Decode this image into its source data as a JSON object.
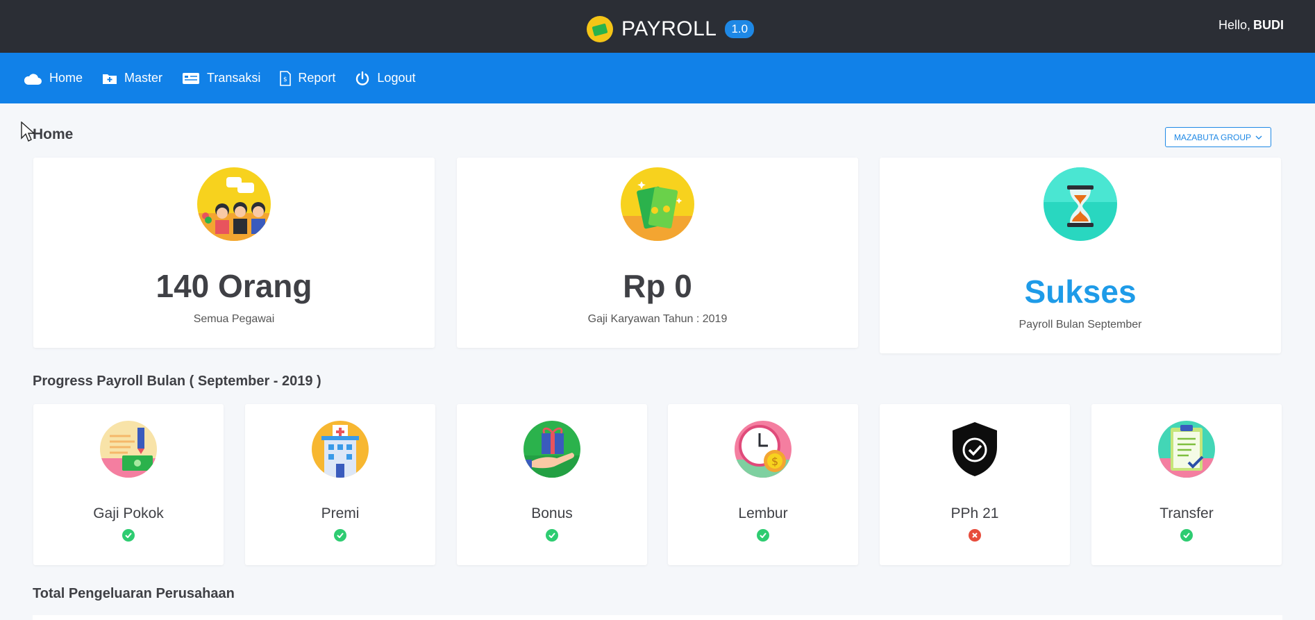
{
  "app": {
    "name": "PAYROLL",
    "version": "1.0",
    "greeting": "Hello,",
    "user": "BUDI"
  },
  "nav": [
    {
      "label": "Home",
      "icon": "cloud-icon"
    },
    {
      "label": "Master",
      "icon": "folder-plus-icon"
    },
    {
      "label": "Transaksi",
      "icon": "card-icon"
    },
    {
      "label": "Report",
      "icon": "invoice-icon"
    },
    {
      "label": "Logout",
      "icon": "power-icon"
    }
  ],
  "page": {
    "title": "Home",
    "company": "MAZABUTA GROUP"
  },
  "stats": [
    {
      "value": "140 Orang",
      "label": "Semua Pegawai",
      "icon": "people-icon"
    },
    {
      "value": "Rp 0",
      "label": "Gaji Karyawan Tahun : 2019",
      "icon": "money-icon"
    },
    {
      "value": "Sukses",
      "label": "Payroll Bulan September",
      "icon": "hourglass-icon"
    }
  ],
  "progress": {
    "title": "Progress Payroll Bulan ( September - 2019 )",
    "items": [
      {
        "label": "Gaji Pokok",
        "status": "done",
        "icon": "salary-icon"
      },
      {
        "label": "Premi",
        "status": "done",
        "icon": "hospital-icon"
      },
      {
        "label": "Bonus",
        "status": "done",
        "icon": "gift-icon"
      },
      {
        "label": "Lembur",
        "status": "done",
        "icon": "clock-coin-icon"
      },
      {
        "label": "PPh 21",
        "status": "failed",
        "icon": "shield-check-icon"
      },
      {
        "label": "Transfer",
        "status": "done",
        "icon": "clipboard-check-icon"
      }
    ]
  },
  "expenses": {
    "title": "Total Pengeluaran Perusahaan"
  },
  "colors": {
    "topbar": "#2b2e35",
    "navbar": "#1181e8",
    "accent": "#1e88e5",
    "success": "#2ecc71",
    "danger": "#e74c3c"
  }
}
